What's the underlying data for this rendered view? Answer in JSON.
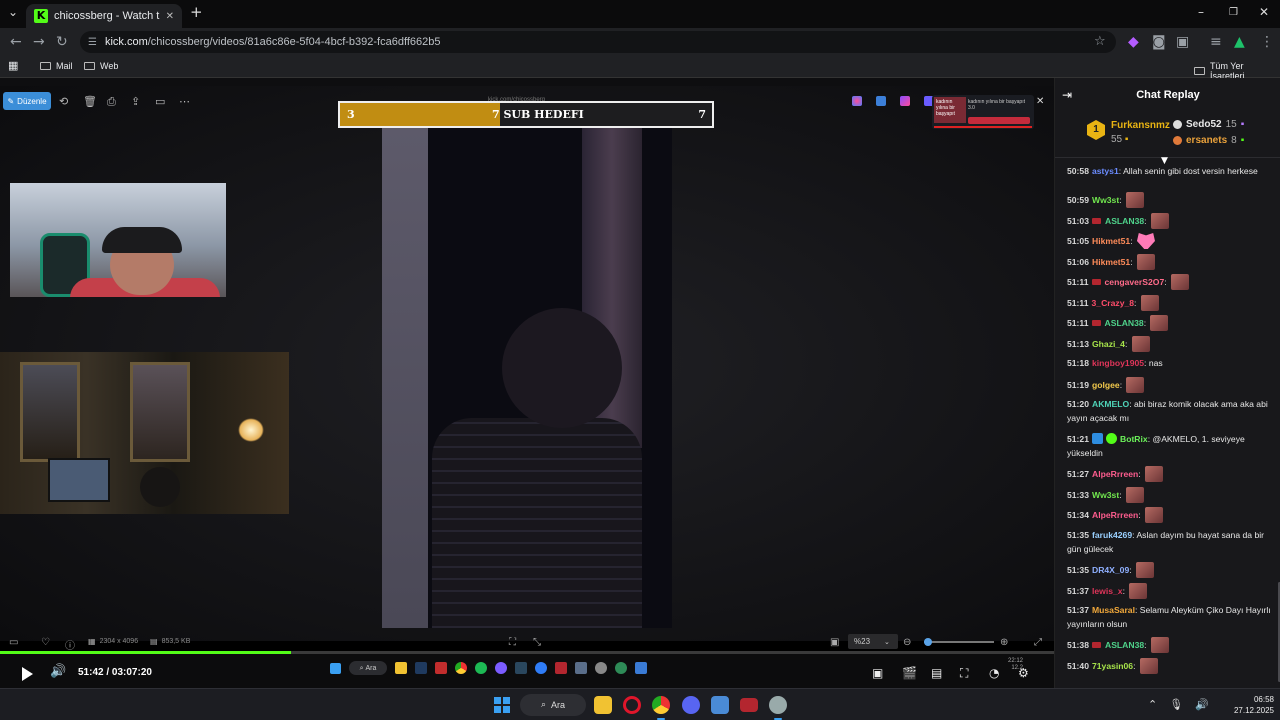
{
  "browser": {
    "tab_title": "chicossberg - Watch the VOD o",
    "tab_favicon": "K",
    "url_host": "kick.com",
    "url_path": "/chicossberg/videos/81a6c86e-5f04-4bcf-b392-fca6dff662b5",
    "bookmarks": [
      "Mail",
      "Web"
    ],
    "all_bookmarks_label": "Tüm Yer İşaretleri"
  },
  "viewer": {
    "edit_label": "Düzenle",
    "image_dims": "2304 x 4096",
    "file_size": "853,5 KB",
    "zoom": "%23"
  },
  "goal": {
    "start": "3",
    "label": "7 SUB HEDEFI",
    "end": "7",
    "progress": 0.43,
    "tiny_text": "kick.com/chicossberg"
  },
  "popup": {
    "thumb_text": "kadının yılına bir başyapıt",
    "text": "kadının yılına bir başyapıt 3.0"
  },
  "player": {
    "time_current": "51:42",
    "time_total": "03:07:20",
    "progress": 0.276
  },
  "embedded_taskbar": {
    "search": "Ara",
    "clock_time": "22:12",
    "clock_date": "12.2"
  },
  "chat": {
    "title": "Chat Replay",
    "leaderboard": {
      "first": {
        "rank": "1",
        "name": "Furkansnmz",
        "count": "55"
      },
      "second": {
        "name": "Sedo52",
        "count": "15"
      },
      "third": {
        "name": "ersanets",
        "count": "8"
      }
    },
    "messages": [
      {
        "time": "50:58",
        "user": "astys1",
        "color": "#6b8cff",
        "text": "Allah senin gibi dost versin herkese",
        "emote": false
      },
      {
        "time": "50:59",
        "user": "Ww3st",
        "color": "#72e84f",
        "text": "",
        "emote": true
      },
      {
        "time": "51:03",
        "user": "ASLAN38",
        "color": "#4fd38b",
        "text": "",
        "emote": true,
        "badge": "red"
      },
      {
        "time": "51:05",
        "user": "Hikmet51",
        "color": "#ff8c5a",
        "text": "",
        "emote": true,
        "pink": true
      },
      {
        "time": "51:06",
        "user": "Hikmet51",
        "color": "#ff8c5a",
        "text": "",
        "emote": true
      },
      {
        "time": "51:11",
        "user": "cengaverS2O7",
        "color": "#ff6b8a",
        "text": "",
        "emote": true,
        "badge": "red"
      },
      {
        "time": "51:11",
        "user": "3_Crazy_8",
        "color": "#ff4d6b",
        "text": "",
        "emote": true
      },
      {
        "time": "51:11",
        "user": "ASLAN38",
        "color": "#4fd38b",
        "text": "",
        "emote": true,
        "badge": "red"
      },
      {
        "time": "51:13",
        "user": "Ghazi_4",
        "color": "#a6e34a",
        "text": "",
        "emote": true
      },
      {
        "time": "51:18",
        "user": "kingboy1905",
        "color": "#e0355a",
        "text": "nas",
        "emote": false
      },
      {
        "time": "51:19",
        "user": "golgee",
        "color": "#f2c94c",
        "text": "",
        "emote": true
      },
      {
        "time": "51:20",
        "user": "AKMELO",
        "color": "#4fd3b8",
        "text": "abi biraz komik olacak ama aka abi yayın açacak mı",
        "emote": false
      },
      {
        "time": "51:21",
        "user": "BotRix",
        "color": "#6cf25a",
        "text": "@AKMELO, 1. seviyeye yükseldin",
        "emote": false,
        "badge": "bot"
      },
      {
        "time": "51:27",
        "user": "AlpeRrreen",
        "color": "#ff5d8f",
        "text": "",
        "emote": true
      },
      {
        "time": "51:33",
        "user": "Ww3st",
        "color": "#72e84f",
        "text": "",
        "emote": true
      },
      {
        "time": "51:34",
        "user": "AlpeRrreen",
        "color": "#ff5d8f",
        "text": "",
        "emote": true
      },
      {
        "time": "51:35",
        "user": "faruk4269",
        "color": "#9ad0ff",
        "text": "Aslan dayım bu hayat sana da bir gün gülecek",
        "emote": false
      },
      {
        "time": "51:35",
        "user": "DR4X_09",
        "color": "#8fb0ff",
        "text": "",
        "emote": true
      },
      {
        "time": "51:37",
        "user": "lewis_x",
        "color": "#e0355a",
        "text": "",
        "emote": true
      },
      {
        "time": "51:37",
        "user": "MusaSaral",
        "color": "#f2a93b",
        "text": "Selamu Aleyküm Çiko Dayı Hayırlı yayınların olsun",
        "emote": false
      },
      {
        "time": "51:38",
        "user": "ASLAN38",
        "color": "#4fd38b",
        "text": "",
        "emote": true,
        "badge": "red"
      },
      {
        "time": "51:40",
        "user": "71yasin06",
        "color": "#a6e34a",
        "text": "",
        "emote": true
      }
    ]
  },
  "taskbar": {
    "search": "Ara",
    "time": "06:58",
    "date": "27.12.2025"
  }
}
